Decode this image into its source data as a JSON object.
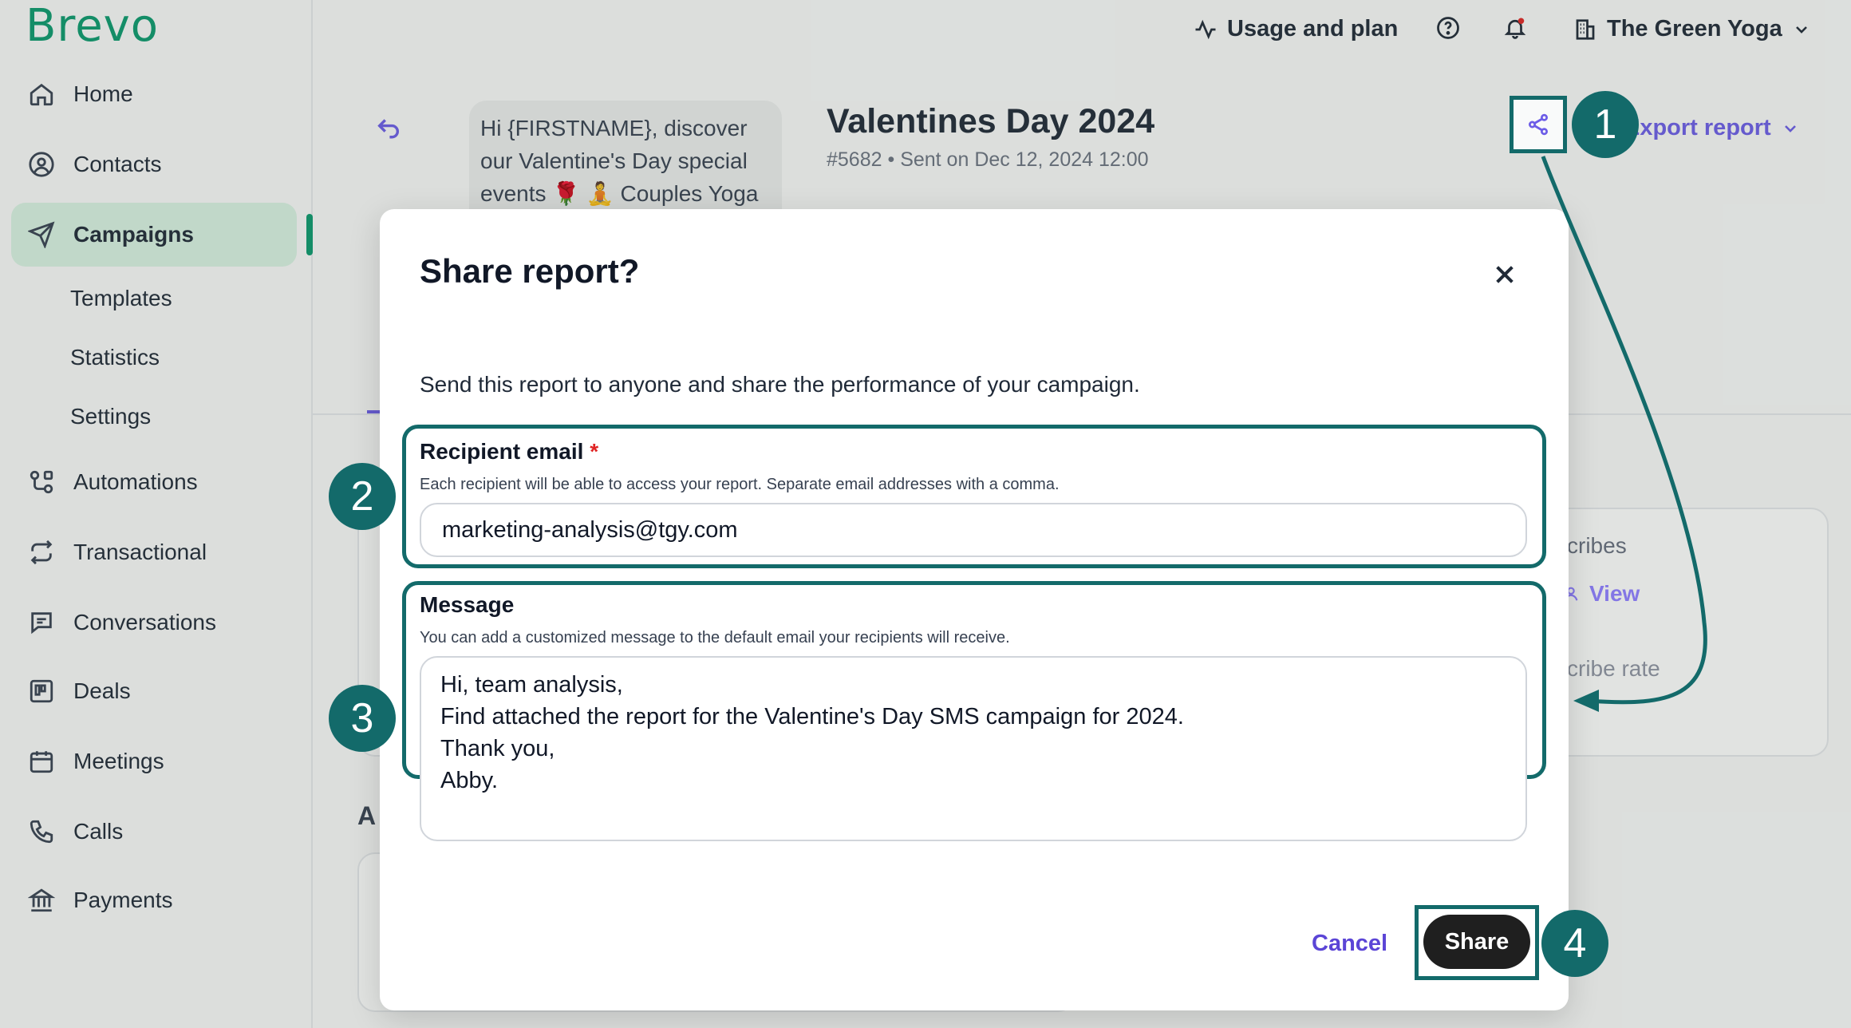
{
  "brand": {
    "logo": "Brevo"
  },
  "sidebar": {
    "items": [
      {
        "label": "Home"
      },
      {
        "label": "Contacts"
      },
      {
        "label": "Campaigns"
      },
      {
        "label": "Automations"
      },
      {
        "label": "Transactional"
      },
      {
        "label": "Conversations"
      },
      {
        "label": "Deals"
      },
      {
        "label": "Meetings"
      },
      {
        "label": "Calls"
      },
      {
        "label": "Payments"
      }
    ],
    "sub_items": [
      {
        "label": "Templates"
      },
      {
        "label": "Statistics"
      },
      {
        "label": "Settings"
      }
    ]
  },
  "topbar": {
    "usage_label": "Usage and plan",
    "account_name": "The Green Yoga"
  },
  "campaign": {
    "preview_text": "Hi {FIRSTNAME}, discover our Valentine's Day special events 🌹 🧘 Couples Yoga",
    "title": "Valentines Day 2024",
    "id": "#5682",
    "sent": "Sent on Dec 12, 2024 12:00",
    "export_label": "Export report"
  },
  "background_fragments": {
    "unsubscribes": "cribes",
    "view": "View",
    "unsub_rate": "cribe rate",
    "section_partial": "A"
  },
  "modal": {
    "title": "Share report?",
    "description": "Send this report to anyone and share the performance of your campaign.",
    "recipient_label": "Recipient email",
    "required_mark": "*",
    "recipient_help": "Each recipient will be able to access your report. Separate email addresses with a comma.",
    "recipient_value": "marketing-analysis@tgy.com",
    "message_label": "Message",
    "message_help": "You can add a customized message to the default email your recipients will receive.",
    "message_value": "Hi, team analysis,\nFind attached the report for the Valentine's Day SMS campaign for 2024.\nThank you,\nAbby.",
    "cancel_label": "Cancel",
    "share_label": "Share"
  },
  "markers": [
    "1",
    "2",
    "3",
    "4"
  ],
  "colors": {
    "brand_green": "#0b996e",
    "annotation_teal": "#136a6a",
    "link_purple": "#6c5ce7",
    "active_nav_bg": "#d9f2e3"
  }
}
